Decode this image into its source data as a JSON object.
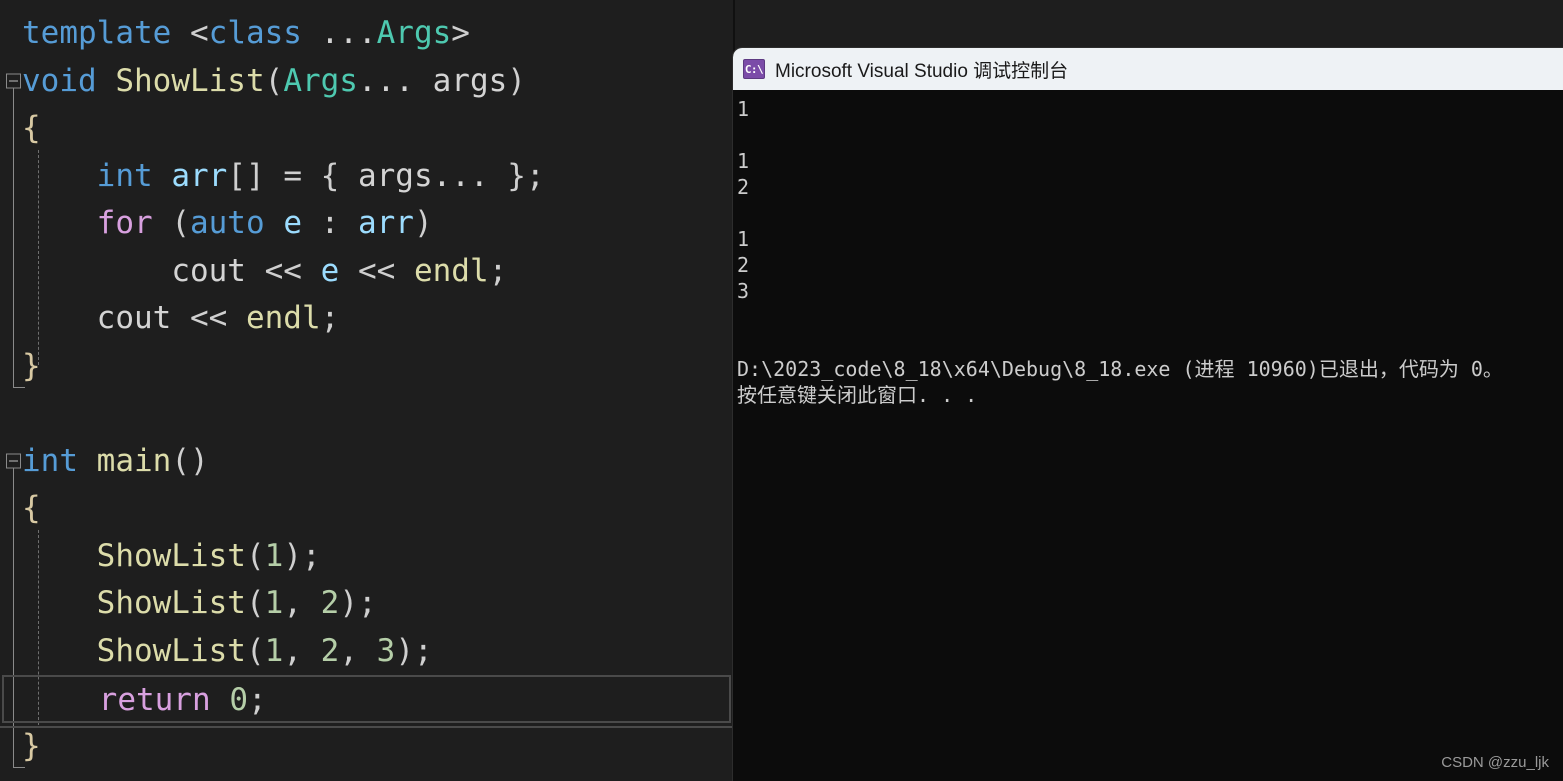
{
  "editor": {
    "background": "#1e1e1e",
    "lines": [
      {
        "id": "l1",
        "fold": false,
        "current": false,
        "tokens": [
          {
            "t": "template",
            "c": "kw"
          },
          {
            "t": " ",
            "c": "plain"
          },
          {
            "t": "<",
            "c": "punc"
          },
          {
            "t": "class",
            "c": "kw"
          },
          {
            "t": " ...",
            "c": "plain"
          },
          {
            "t": "Args",
            "c": "type"
          },
          {
            "t": ">",
            "c": "punc"
          }
        ]
      },
      {
        "id": "l2",
        "fold": true,
        "current": false,
        "tokens": [
          {
            "t": "void",
            "c": "kw"
          },
          {
            "t": " ",
            "c": "plain"
          },
          {
            "t": "ShowList",
            "c": "fn"
          },
          {
            "t": "(",
            "c": "punc"
          },
          {
            "t": "Args",
            "c": "type"
          },
          {
            "t": "... ",
            "c": "plain"
          },
          {
            "t": "args",
            "c": "plain"
          },
          {
            "t": ")",
            "c": "punc"
          }
        ]
      },
      {
        "id": "l3",
        "fold": false,
        "current": false,
        "tokens": [
          {
            "t": "{",
            "c": "brace"
          }
        ]
      },
      {
        "id": "l4",
        "fold": false,
        "current": false,
        "tokens": [
          {
            "t": "    ",
            "c": "plain"
          },
          {
            "t": "int",
            "c": "kw"
          },
          {
            "t": " ",
            "c": "plain"
          },
          {
            "t": "arr",
            "c": "var"
          },
          {
            "t": "[] ",
            "c": "punc"
          },
          {
            "t": "= { ",
            "c": "punc"
          },
          {
            "t": "args",
            "c": "plain"
          },
          {
            "t": "... ",
            "c": "plain"
          },
          {
            "t": "};",
            "c": "punc"
          }
        ]
      },
      {
        "id": "l5",
        "fold": false,
        "current": false,
        "tokens": [
          {
            "t": "    ",
            "c": "plain"
          },
          {
            "t": "for",
            "c": "ctrl"
          },
          {
            "t": " (",
            "c": "punc"
          },
          {
            "t": "auto",
            "c": "kw"
          },
          {
            "t": " ",
            "c": "plain"
          },
          {
            "t": "e",
            "c": "var"
          },
          {
            "t": " : ",
            "c": "punc"
          },
          {
            "t": "arr",
            "c": "var"
          },
          {
            "t": ")",
            "c": "punc"
          }
        ]
      },
      {
        "id": "l6",
        "fold": false,
        "current": false,
        "tokens": [
          {
            "t": "        ",
            "c": "plain"
          },
          {
            "t": "cout",
            "c": "plain"
          },
          {
            "t": " << ",
            "c": "punc"
          },
          {
            "t": "e",
            "c": "var"
          },
          {
            "t": " << ",
            "c": "punc"
          },
          {
            "t": "endl",
            "c": "fn"
          },
          {
            "t": ";",
            "c": "punc"
          }
        ]
      },
      {
        "id": "l7",
        "fold": false,
        "current": false,
        "tokens": [
          {
            "t": "    ",
            "c": "plain"
          },
          {
            "t": "cout",
            "c": "plain"
          },
          {
            "t": " << ",
            "c": "punc"
          },
          {
            "t": "endl",
            "c": "fn"
          },
          {
            "t": ";",
            "c": "punc"
          }
        ]
      },
      {
        "id": "l8",
        "fold": false,
        "current": false,
        "tokens": [
          {
            "t": "}",
            "c": "brace"
          }
        ]
      },
      {
        "id": "l9",
        "fold": false,
        "current": false,
        "tokens": [
          {
            "t": "",
            "c": "plain"
          }
        ]
      },
      {
        "id": "l10",
        "fold": true,
        "current": false,
        "tokens": [
          {
            "t": "int",
            "c": "kw"
          },
          {
            "t": " ",
            "c": "plain"
          },
          {
            "t": "main",
            "c": "fn"
          },
          {
            "t": "()",
            "c": "punc"
          }
        ]
      },
      {
        "id": "l11",
        "fold": false,
        "current": false,
        "tokens": [
          {
            "t": "{",
            "c": "brace"
          }
        ]
      },
      {
        "id": "l12",
        "fold": false,
        "current": false,
        "tokens": [
          {
            "t": "    ",
            "c": "plain"
          },
          {
            "t": "ShowList",
            "c": "fn"
          },
          {
            "t": "(",
            "c": "punc"
          },
          {
            "t": "1",
            "c": "num"
          },
          {
            "t": ");",
            "c": "punc"
          }
        ]
      },
      {
        "id": "l13",
        "fold": false,
        "current": false,
        "tokens": [
          {
            "t": "    ",
            "c": "plain"
          },
          {
            "t": "ShowList",
            "c": "fn"
          },
          {
            "t": "(",
            "c": "punc"
          },
          {
            "t": "1",
            "c": "num"
          },
          {
            "t": ", ",
            "c": "punc"
          },
          {
            "t": "2",
            "c": "num"
          },
          {
            "t": ");",
            "c": "punc"
          }
        ]
      },
      {
        "id": "l14",
        "fold": false,
        "current": false,
        "tokens": [
          {
            "t": "    ",
            "c": "plain"
          },
          {
            "t": "ShowList",
            "c": "fn"
          },
          {
            "t": "(",
            "c": "punc"
          },
          {
            "t": "1",
            "c": "num"
          },
          {
            "t": ", ",
            "c": "punc"
          },
          {
            "t": "2",
            "c": "num"
          },
          {
            "t": ", ",
            "c": "punc"
          },
          {
            "t": "3",
            "c": "num"
          },
          {
            "t": ");",
            "c": "punc"
          }
        ]
      },
      {
        "id": "l15",
        "fold": false,
        "current": true,
        "tokens": [
          {
            "t": "    ",
            "c": "plain"
          },
          {
            "t": "return",
            "c": "ctrl"
          },
          {
            "t": " ",
            "c": "plain"
          },
          {
            "t": "0",
            "c": "num"
          },
          {
            "t": ";",
            "c": "punc"
          }
        ]
      },
      {
        "id": "l16",
        "fold": false,
        "current": false,
        "tokens": [
          {
            "t": "}",
            "c": "brace"
          }
        ]
      }
    ]
  },
  "console": {
    "title": "Microsoft Visual Studio 调试控制台",
    "icon_label": "C:\\",
    "output": [
      "1",
      "",
      "1",
      "2",
      "",
      "1",
      "2",
      "3",
      "",
      "",
      "D:\\2023_code\\8_18\\x64\\Debug\\8_18.exe (进程 10960)已退出，代码为 0。",
      "按任意键关闭此窗口. . ."
    ]
  },
  "watermark": {
    "text": "CSDN @zzu_ljk"
  }
}
